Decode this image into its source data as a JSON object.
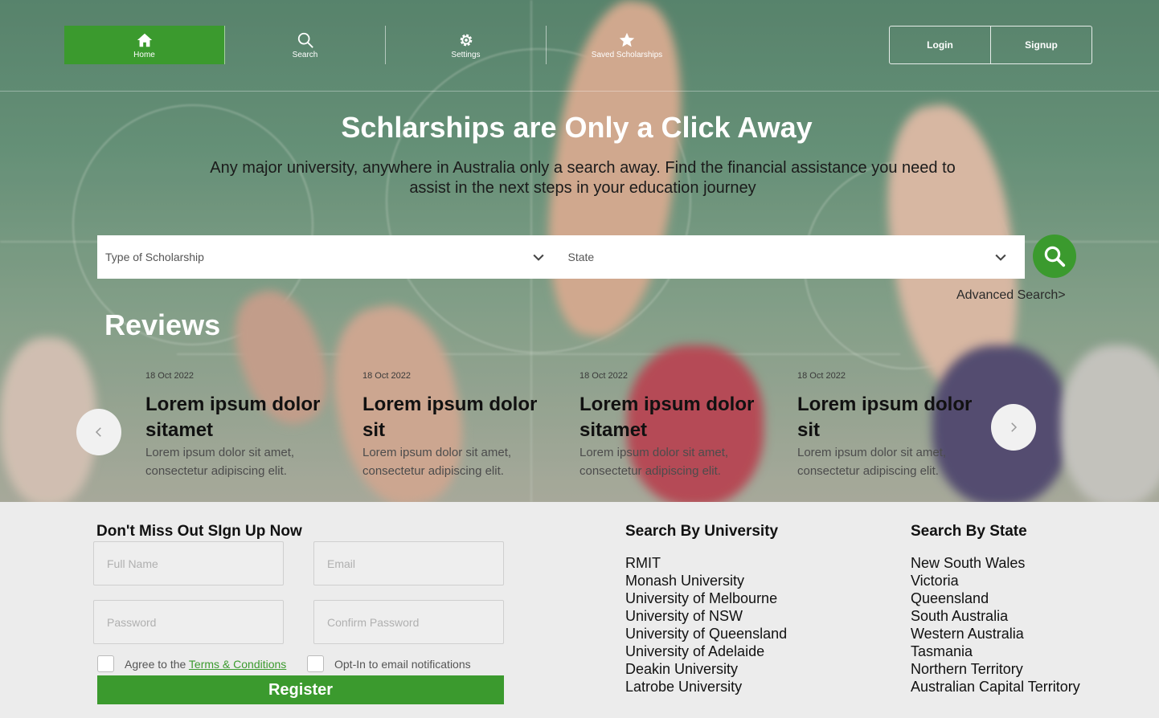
{
  "nav": {
    "items": [
      {
        "label": "Home",
        "icon": "home-icon",
        "active": true
      },
      {
        "label": "Search",
        "icon": "search-icon",
        "active": false
      },
      {
        "label": "Settings",
        "icon": "gear-icon",
        "active": false
      },
      {
        "label": "Saved Scholarships",
        "icon": "star-icon",
        "active": false
      }
    ],
    "login_label": "Login",
    "signup_label": "Signup"
  },
  "hero": {
    "title": "Schlarships are Only a Click Away",
    "subtitle": "Any major university, anywhere in Australia only a search away. Find the financial assistance you need to assist in the next steps in your education journey"
  },
  "search": {
    "type_placeholder": "Type of Scholarship",
    "state_placeholder": "State",
    "advanced_label": "Advanced Search>"
  },
  "reviews": {
    "title": "Reviews",
    "items": [
      {
        "date": "18 Oct 2022",
        "title": "Lorem ipsum dolor sitamet",
        "body": "Lorem ipsum dolor sit amet, consectetur adipiscing elit."
      },
      {
        "date": "18 Oct 2022",
        "title": "Lorem ipsum dolor sit",
        "body": "Lorem ipsum dolor sit amet, consectetur adipiscing elit."
      },
      {
        "date": "18 Oct 2022",
        "title": "Lorem ipsum dolor sitamet",
        "body": "Lorem ipsum dolor sit amet, consectetur adipiscing elit."
      },
      {
        "date": "18 Oct 2022",
        "title": "Lorem ipsum dolor sit",
        "body": "Lorem ipsum dolor sit amet, consectetur adipiscing elit."
      }
    ]
  },
  "signup": {
    "title": "Don't Miss Out SIgn Up Now",
    "full_name_placeholder": "Full Name",
    "email_placeholder": "Email",
    "password_placeholder": "Password",
    "confirm_password_placeholder": "Confirm Password",
    "agree_prefix": "Agree to the ",
    "terms_link": "Terms & Conditions",
    "optin_label": "Opt-In to email notifications",
    "register_label": "Register"
  },
  "by_university": {
    "title": "Search By University",
    "items": [
      "RMIT",
      "Monash University",
      "University of Melbourne",
      "University of NSW",
      "University of Queensland",
      "University of Adelaide",
      "Deakin University",
      "Latrobe University"
    ]
  },
  "by_state": {
    "title": "Search By State",
    "items": [
      "New South Wales",
      "Victoria",
      "Queensland",
      "South Australia",
      "Western Australia",
      "Tasmania",
      "Northern Territory",
      "Australian Capital Territory"
    ]
  },
  "colors": {
    "accent": "#3b9a2e",
    "footer_bg": "#ececec"
  }
}
